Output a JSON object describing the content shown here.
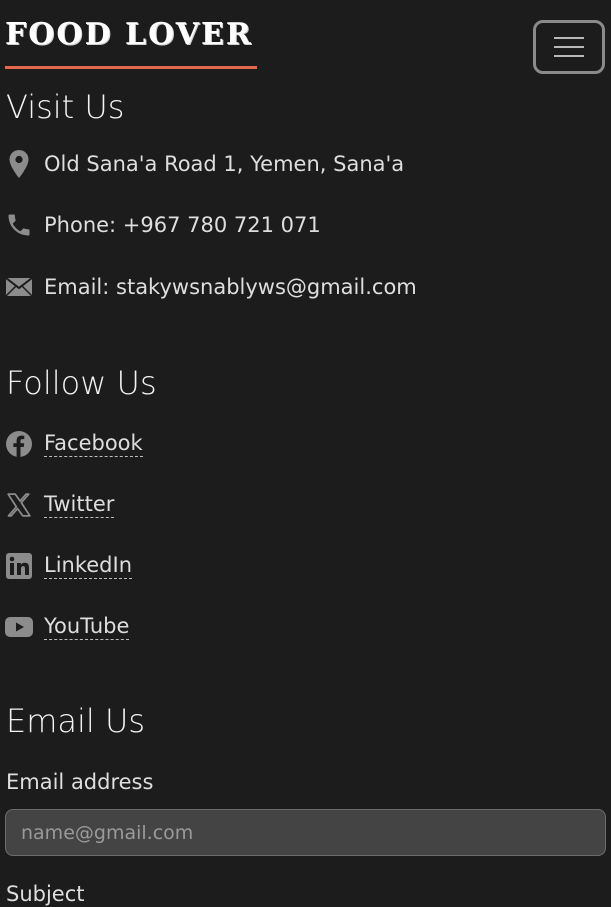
{
  "navbar": {
    "brand": "FOOD LOVER",
    "toggler_icon": "hamburger-menu-icon"
  },
  "visit": {
    "heading": "Visit Us",
    "items": [
      {
        "icon": "location-pin-icon",
        "text": "Old Sana'a Road 1, Yemen, Sana'a"
      },
      {
        "icon": "phone-icon",
        "text": "Phone: +967 780 721 071"
      },
      {
        "icon": "envelope-icon",
        "text": "Email: stakywsnablyws@gmail.com"
      }
    ]
  },
  "follow": {
    "heading": "Follow Us",
    "links": [
      {
        "icon": "facebook-icon",
        "label": "Facebook"
      },
      {
        "icon": "x-twitter-icon",
        "label": "Twitter"
      },
      {
        "icon": "linkedin-icon",
        "label": "LinkedIn"
      },
      {
        "icon": "youtube-icon",
        "label": "YouTube"
      }
    ]
  },
  "email_form": {
    "heading": "Email Us",
    "email_label": "Email address",
    "email_placeholder": "name@gmail.com",
    "email_value": "",
    "subject_label": "Subject"
  },
  "colors": {
    "background": "#1c1c1c",
    "accent_underline": "#e06a4b",
    "icon_gray": "#8c8c8c"
  }
}
